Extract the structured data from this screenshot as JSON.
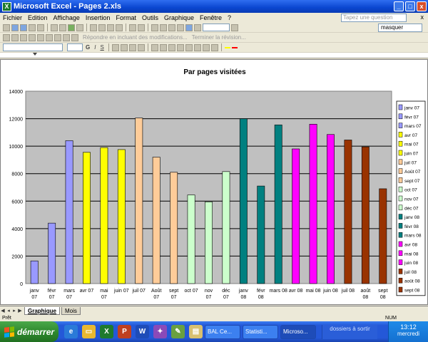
{
  "window": {
    "title": "Microsoft Excel - Pages 2.xls",
    "controls": [
      "_",
      "□",
      "x"
    ]
  },
  "menu": {
    "items": [
      "Fichier",
      "Edition",
      "Affichage",
      "Insertion",
      "Format",
      "Outils",
      "Graphique",
      "Fenêtre",
      "?"
    ],
    "help_placeholder": "Tapez une question",
    "doc_close": "x"
  },
  "toolbar": {
    "masquer_label": "masquer",
    "reply_label": "Répondre en incluant des modifications...",
    "end_review_label": "Terminer la révision...",
    "format_letters": [
      "G",
      "I",
      "S"
    ]
  },
  "chart_data": {
    "type": "bar",
    "title": "Par pages visitées",
    "categories": [
      "janv 07",
      "févr 07",
      "mars 07",
      "avr 07",
      "mai 07",
      "juin 07",
      "juil 07",
      "Août 07",
      "sept 07",
      "oct 07",
      "nov 07",
      "déc 07",
      "janv 08",
      "févr 08",
      "mars 08",
      "avr 08",
      "mai 08",
      "juin 08",
      "juil 08",
      "août 08",
      "sept 08"
    ],
    "x_tick_labels": [
      [
        "janv",
        "07"
      ],
      [
        "févr",
        "07"
      ],
      [
        "mars",
        "07"
      ],
      [
        "avr 07",
        ""
      ],
      [
        "mai",
        "07"
      ],
      [
        "juin 07",
        ""
      ],
      [
        "juil 07",
        ""
      ],
      [
        "Août",
        "07"
      ],
      [
        "sept",
        "07"
      ],
      [
        "oct 07",
        ""
      ],
      [
        "nov",
        "07"
      ],
      [
        "déc",
        "07"
      ],
      [
        "janv",
        "08"
      ],
      [
        "févr",
        "08"
      ],
      [
        "mars 08",
        ""
      ],
      [
        "avr 08",
        ""
      ],
      [
        "mai 08",
        ""
      ],
      [
        "juin 08",
        ""
      ],
      [
        "juil 08",
        ""
      ],
      [
        "août",
        "08"
      ],
      [
        "sept",
        "08"
      ]
    ],
    "legend_labels": [
      "janv 07",
      "févr 07",
      "mars 07",
      "avr 07",
      "mai 07",
      "juin 07",
      "juil 07",
      "Août 07",
      "sept 07",
      "oct 07",
      "nov 07",
      "déc 07",
      "janv 08",
      "févr 08",
      "mars 08",
      "avr 08",
      "mai 08",
      "juin 08",
      "juil 08",
      "août 08",
      "sept 08"
    ],
    "values": [
      1650,
      4400,
      10400,
      9550,
      9900,
      9750,
      12050,
      9200,
      8100,
      6450,
      5950,
      8150,
      12000,
      7100,
      11550,
      9800,
      11600,
      10850,
      10450,
      9950,
      6900
    ],
    "colors": [
      "#9999ff",
      "#9999ff",
      "#9999ff",
      "#ffff00",
      "#ffff00",
      "#ffff00",
      "#ffcc99",
      "#ffcc99",
      "#ffcc99",
      "#ccffcc",
      "#ccffcc",
      "#ccffcc",
      "#008080",
      "#008080",
      "#008080",
      "#ff00ff",
      "#ff00ff",
      "#ff00ff",
      "#993300",
      "#993300",
      "#993300"
    ],
    "y_ticks": [
      "0",
      "2000",
      "4000",
      "6000",
      "8000",
      "10000",
      "12000",
      "14000"
    ],
    "ylim": [
      0,
      14000
    ],
    "grid": true,
    "legend_position": "right",
    "plot_background": "#c0c0c0"
  },
  "sheet_tabs": {
    "tabs": [
      "Graphique",
      "Mois"
    ],
    "active": "Graphique"
  },
  "status": {
    "ready": "Prêt",
    "num": "NUM"
  },
  "taskbar": {
    "start_label": "démarrer",
    "buttons": [
      "BAL Ce...",
      "Statisti...",
      "Microso..."
    ],
    "group_label": "dossiers à sortir",
    "clock": "13:12",
    "day": "mercredi"
  }
}
